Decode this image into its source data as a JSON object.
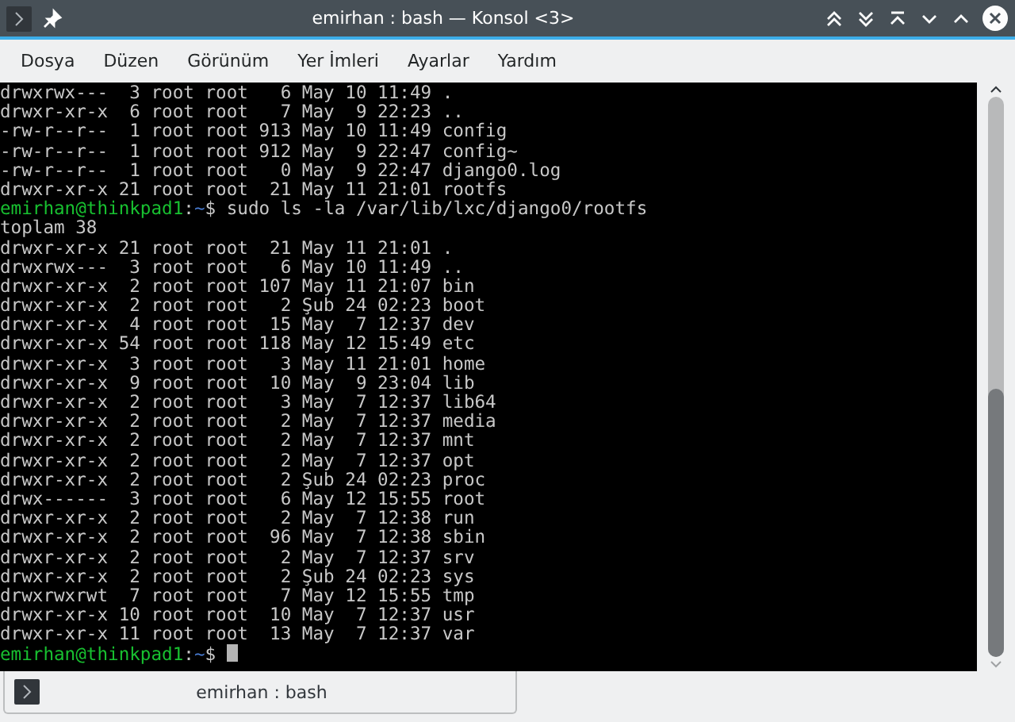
{
  "window": {
    "title": "emirhan : bash — Konsol <3>"
  },
  "menu": [
    "Dosya",
    "Düzen",
    "Görünüm",
    "Yer İmleri",
    "Ayarlar",
    "Yardım"
  ],
  "terminal": {
    "lines": [
      {
        "kind": "output",
        "text": "drwxrwx---  3 root root   6 May 10 11:49 ."
      },
      {
        "kind": "output",
        "text": "drwxr-xr-x  6 root root   7 May  9 22:23 .."
      },
      {
        "kind": "output",
        "text": "-rw-r--r--  1 root root 913 May 10 11:49 config"
      },
      {
        "kind": "output",
        "text": "-rw-r--r--  1 root root 912 May  9 22:47 config~"
      },
      {
        "kind": "output",
        "text": "-rw-r--r--  1 root root   0 May  9 22:47 django0.log"
      },
      {
        "kind": "output",
        "text": "drwxr-xr-x 21 root root  21 May 11 21:01 rootfs"
      },
      {
        "kind": "prompt",
        "user": "emirhan@thinkpad1",
        "separator": ":",
        "path": "~",
        "symbol": "$",
        "command": " sudo ls -la /var/lib/lxc/django0/rootfs",
        "cursor": false
      },
      {
        "kind": "output",
        "text": "toplam 38"
      },
      {
        "kind": "output",
        "text": "drwxr-xr-x 21 root root  21 May 11 21:01 ."
      },
      {
        "kind": "output",
        "text": "drwxrwx---  3 root root   6 May 10 11:49 .."
      },
      {
        "kind": "output",
        "text": "drwxr-xr-x  2 root root 107 May 11 21:07 bin"
      },
      {
        "kind": "output",
        "text": "drwxr-xr-x  2 root root   2 Şub 24 02:23 boot"
      },
      {
        "kind": "output",
        "text": "drwxr-xr-x  4 root root  15 May  7 12:37 dev"
      },
      {
        "kind": "output",
        "text": "drwxr-xr-x 54 root root 118 May 12 15:49 etc"
      },
      {
        "kind": "output",
        "text": "drwxr-xr-x  3 root root   3 May 11 21:01 home"
      },
      {
        "kind": "output",
        "text": "drwxr-xr-x  9 root root  10 May  9 23:04 lib"
      },
      {
        "kind": "output",
        "text": "drwxr-xr-x  2 root root   3 May  7 12:37 lib64"
      },
      {
        "kind": "output",
        "text": "drwxr-xr-x  2 root root   2 May  7 12:37 media"
      },
      {
        "kind": "output",
        "text": "drwxr-xr-x  2 root root   2 May  7 12:37 mnt"
      },
      {
        "kind": "output",
        "text": "drwxr-xr-x  2 root root   2 May  7 12:37 opt"
      },
      {
        "kind": "output",
        "text": "drwxr-xr-x  2 root root   2 Şub 24 02:23 proc"
      },
      {
        "kind": "output",
        "text": "drwx------  3 root root   6 May 12 15:55 root"
      },
      {
        "kind": "output",
        "text": "drwxr-xr-x  2 root root   2 May  7 12:38 run"
      },
      {
        "kind": "output",
        "text": "drwxr-xr-x  2 root root  96 May  7 12:38 sbin"
      },
      {
        "kind": "output",
        "text": "drwxr-xr-x  2 root root   2 May  7 12:37 srv"
      },
      {
        "kind": "output",
        "text": "drwxr-xr-x  2 root root   2 Şub 24 02:23 sys"
      },
      {
        "kind": "output",
        "text": "drwxrwxrwt  7 root root   7 May 12 15:55 tmp"
      },
      {
        "kind": "output",
        "text": "drwxr-xr-x 10 root root  10 May  7 12:37 usr"
      },
      {
        "kind": "output",
        "text": "drwxr-xr-x 11 root root  13 May  7 12:37 var"
      },
      {
        "kind": "prompt",
        "user": "emirhan@thinkpad1",
        "separator": ":",
        "path": "~",
        "symbol": "$",
        "cursor": true
      }
    ]
  },
  "tabs": [
    {
      "label": "emirhan : bash",
      "selected": true
    }
  ]
}
